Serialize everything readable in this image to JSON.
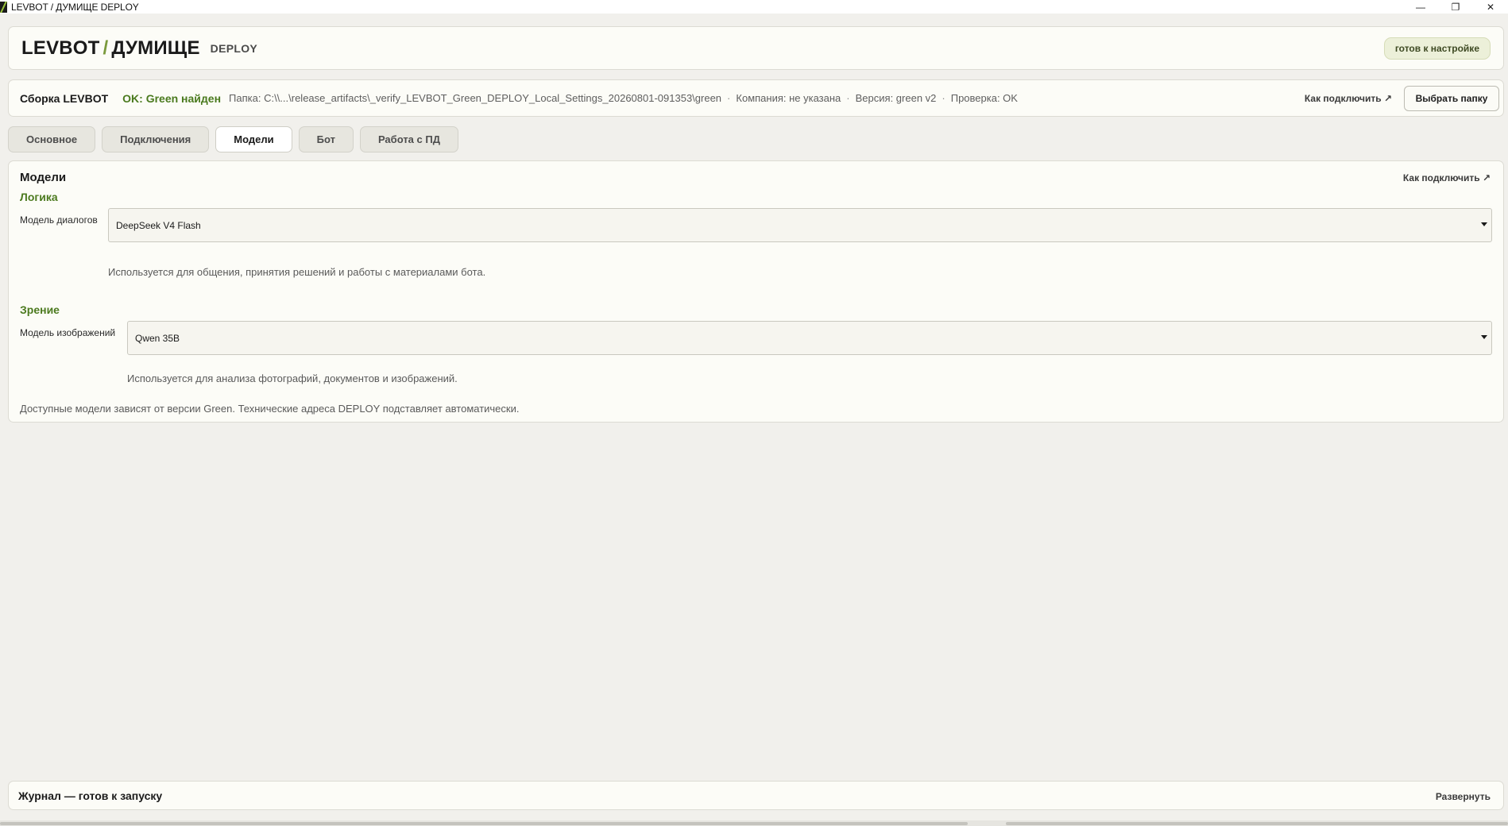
{
  "window": {
    "title": "LEVBOT / ДУМИЩЕ DEPLOY",
    "controls": {
      "minimize": "—",
      "restore": "❐",
      "close": "✕"
    }
  },
  "header": {
    "brand_left": "LEVBOT",
    "brand_slash": "/",
    "brand_right": "ДУМИЩЕ",
    "subtitle": "DEPLOY",
    "status": "готов к настройке"
  },
  "build": {
    "title": "Сборка LEVBOT",
    "ok_text": "OK: Green найден",
    "folder": "Папка: C:\\\\...\\release_artifacts\\_verify_LEVBOT_Green_DEPLOY_Local_Settings_20260801-091353\\green",
    "company": "Компания: не указана",
    "version": "Версия: green v2",
    "check": "Проверка: OK",
    "separator": "·",
    "how_to_connect": "Как подключить ↗",
    "choose_folder": "Выбрать папку"
  },
  "tabs": [
    {
      "label": "Основное",
      "active": false
    },
    {
      "label": "Подключения",
      "active": false
    },
    {
      "label": "Модели",
      "active": true
    },
    {
      "label": "Бот",
      "active": false
    },
    {
      "label": "Работа с ПД",
      "active": false
    }
  ],
  "models": {
    "title": "Модели",
    "how_to_connect": "Как подключить ↗",
    "logic": {
      "section": "Логика",
      "label": "Модель диалогов",
      "value": "DeepSeek V4 Flash",
      "hint": "Используется для общения, принятия решений и работы с материалами бота."
    },
    "vision": {
      "section": "Зрение",
      "label": "Модель изображений",
      "value": "Qwen 35B",
      "hint": "Используется для анализа фотографий, документов и изображений."
    },
    "footer_note": "Доступные модели зависят от версии Green. Технические адреса DEPLOY подставляет автоматически."
  },
  "journal": {
    "title": "Журнал — готов к запуску",
    "expand": "Развернуть"
  },
  "colors": {
    "accent_green": "#4c7a1f",
    "background": "#f1f0ec",
    "card": "#fcfcf7"
  }
}
